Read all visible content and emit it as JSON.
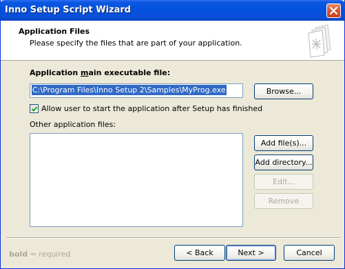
{
  "window": {
    "title": "Inno Setup Script Wizard"
  },
  "header": {
    "title": "Application Files",
    "subtitle": "Please specify the files that are part of your application."
  },
  "main_exe": {
    "label_before": "Application ",
    "label_underlined": "m",
    "label_after": "ain executable file:",
    "value": "C:\\Program Files\\Inno Setup 2\\Samples\\MyProg.exe",
    "browse_label": "Browse..."
  },
  "allow_start": {
    "checked": true,
    "label": "Allow user to start the application after Setup has finished"
  },
  "other_files": {
    "label": "Other application files:",
    "items": [],
    "add_files_label": "Add file(s)...",
    "add_directory_label": "Add directory...",
    "edit_label": "Edit...",
    "remove_label": "Remove"
  },
  "footer": {
    "note_bold": "bold",
    "note_rest": " = required",
    "back_label": "< Back",
    "next_label": "Next >",
    "cancel_label": "Cancel"
  },
  "colors": {
    "titlebar": "#0451df",
    "selection": "#316ac5",
    "dialog_bg": "#ece9d8"
  },
  "icons": [
    "close-icon",
    "wizard-document-icon",
    "checkmark-icon"
  ]
}
